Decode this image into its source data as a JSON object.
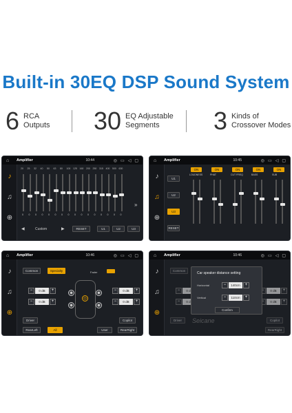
{
  "headline": "Built-in 30EQ DSP Sound System",
  "stats": [
    {
      "num": "6",
      "line1": "RCA",
      "line2": "Outputs"
    },
    {
      "num": "30",
      "line1": "EQ Adjustable",
      "line2": "Segments"
    },
    {
      "num": "3",
      "line1": "Kinds of",
      "line2": "Crossover Modes"
    }
  ],
  "status": {
    "home_glyph": "⌂",
    "app": "Amplifier",
    "time1": "10:44",
    "time2": "10:45",
    "time3": "10:46",
    "time4": "10:46",
    "icons": [
      "◎",
      "▭",
      "◁",
      "▢"
    ]
  },
  "side_glyphs": [
    "♪",
    "♫",
    "⊕"
  ],
  "eq": {
    "freqs": [
      "20",
      "25",
      "32",
      "40",
      "50",
      "63",
      "80",
      "100",
      "125",
      "160",
      "200",
      "250",
      "315",
      "400",
      "500",
      "630"
    ],
    "preset": "Custom",
    "reset": "RESET",
    "u1": "U1",
    "u2": "U2",
    "u3": "U3",
    "zero": "0",
    "arrow_right": "»",
    "prev": "◀",
    "next": "▶",
    "levels": [
      0.55,
      0.4,
      0.5,
      0.45,
      0.3,
      0.55,
      0.5,
      0.5,
      0.5,
      0.5,
      0.5,
      0.5,
      0.45,
      0.45,
      0.4,
      0.45
    ]
  },
  "crossover": {
    "u1": "U1",
    "u2": "U2",
    "u3": "U3",
    "reset": "RESET",
    "on": "ON",
    "columns": [
      "LOUDNESS",
      "PHAT",
      "CUT FREQ",
      "BASS",
      "SUB"
    ]
  },
  "fader": {
    "common": "Common",
    "specialty": "Specialty",
    "fader_label": "Fader",
    "db": "0 dB",
    "driver": "Driver",
    "copilot": "Copilot",
    "rearleft": "RearLeft",
    "all": "All",
    "user": "User",
    "rearright": "RearRight",
    "minus": "−",
    "plus": "+"
  },
  "dialog": {
    "title": "Car speaker distance setting",
    "horizontal": "Horizontal",
    "horizontal_value": "140cm",
    "vertical": "Vertical",
    "vertical_value": "110cm",
    "confirm": "Confirm",
    "watermark": "Seicane"
  },
  "colors": {
    "accent": "#1a78c8",
    "highlight": "#e8a200"
  }
}
